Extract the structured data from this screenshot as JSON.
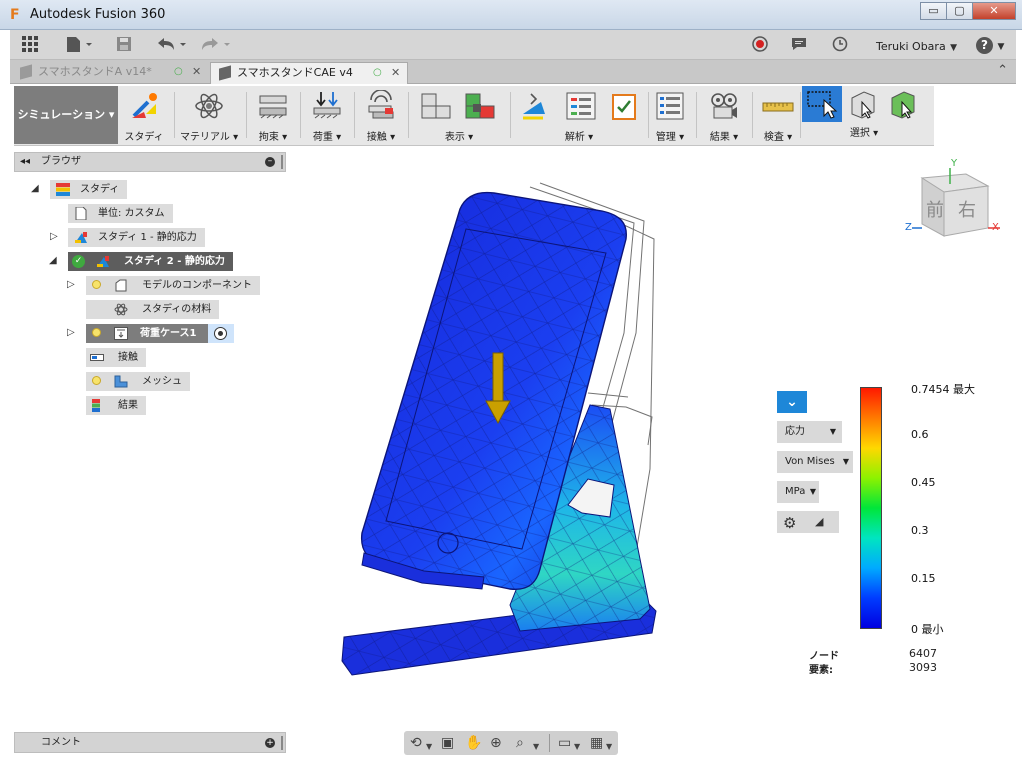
{
  "window": {
    "title": "Autodesk Fusion 360",
    "min": "▭",
    "max": "▢",
    "close": "✕"
  },
  "toolbar": {
    "user": "Teruki Obara",
    "help": "?"
  },
  "tabs": [
    {
      "label": "スマホスタンドA v14*",
      "active": false
    },
    {
      "label": "スマホスタンドCAE v4",
      "active": true
    }
  ],
  "ribbon": {
    "workspace": "シミュレーション ▾",
    "groups": [
      {
        "label": "スタディ"
      },
      {
        "label": "マテリアル ▾"
      },
      {
        "label": "拘束 ▾"
      },
      {
        "label": "荷重 ▾"
      },
      {
        "label": "接触 ▾"
      },
      {
        "label": "表示 ▾"
      },
      {
        "label": "解析 ▾"
      },
      {
        "label": "管理 ▾"
      },
      {
        "label": "結果 ▾"
      },
      {
        "label": "検査 ▾"
      },
      {
        "label": "選択 ▾"
      }
    ]
  },
  "browser": {
    "title": "ブラウザ",
    "nodes": [
      {
        "label": "スタディ"
      },
      {
        "label": "単位: カスタム"
      },
      {
        "label": "スタディ 1 - 静的応力"
      },
      {
        "label": "スタディ 2 - 静的応力"
      },
      {
        "label": "モデルのコンポーネント"
      },
      {
        "label": "スタディの材料"
      },
      {
        "label": "荷重ケース1"
      },
      {
        "label": "接触"
      },
      {
        "label": "メッシュ"
      },
      {
        "label": "結果"
      }
    ]
  },
  "comments": {
    "title": "コメント"
  },
  "viewcube": {
    "front": "前",
    "right": "右",
    "x": "X",
    "y": "Y",
    "z": "Z"
  },
  "legend": {
    "result_type": "応力",
    "criterion": "Von Mises",
    "unit": "MPa",
    "ticks": [
      "0.7454 最大",
      "0.6",
      "0.45",
      "0.3",
      "0.15",
      "0 最小"
    ],
    "nodes_label": "ノード",
    "nodes_value": "6407",
    "elements_label": "要素:",
    "elements_value": "3093"
  }
}
